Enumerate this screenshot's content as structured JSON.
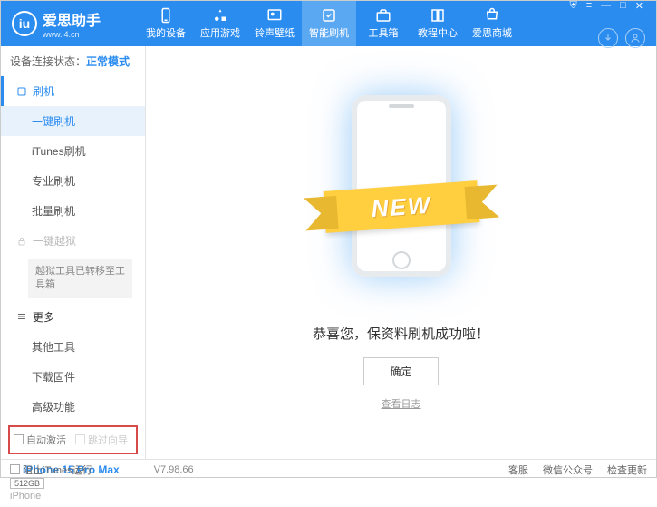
{
  "header": {
    "app_name": "爱思助手",
    "url": "www.i4.cn",
    "nav": [
      {
        "label": "我的设备"
      },
      {
        "label": "应用游戏"
      },
      {
        "label": "铃声壁纸"
      },
      {
        "label": "智能刷机"
      },
      {
        "label": "工具箱"
      },
      {
        "label": "教程中心"
      },
      {
        "label": "爱思商城"
      }
    ]
  },
  "status": {
    "label": "设备连接状态：",
    "value": "正常模式"
  },
  "sidebar": {
    "section_flash": "刷机",
    "items": {
      "onekey": "一键刷机",
      "itunes": "iTunes刷机",
      "pro": "专业刷机",
      "batch": "批量刷机"
    },
    "section_jailbreak": "一键越狱",
    "jailbreak_note": "越狱工具已转移至工具箱",
    "section_more": "更多",
    "more": {
      "other": "其他工具",
      "download": "下载固件",
      "advanced": "高级功能"
    },
    "checks": {
      "auto_activate": "自动激活",
      "skip_setup": "跳过向导"
    },
    "device": {
      "name": "iPhone 15 Pro Max",
      "storage": "512GB",
      "type": "iPhone"
    }
  },
  "main": {
    "ribbon": "NEW",
    "success": "恭喜您，保资料刷机成功啦！",
    "ok": "确定",
    "log": "查看日志"
  },
  "footer": {
    "block": "阻止iTunes运行",
    "version": "V7.98.66",
    "links": {
      "support": "客服",
      "wechat": "微信公众号",
      "update": "检查更新"
    }
  }
}
